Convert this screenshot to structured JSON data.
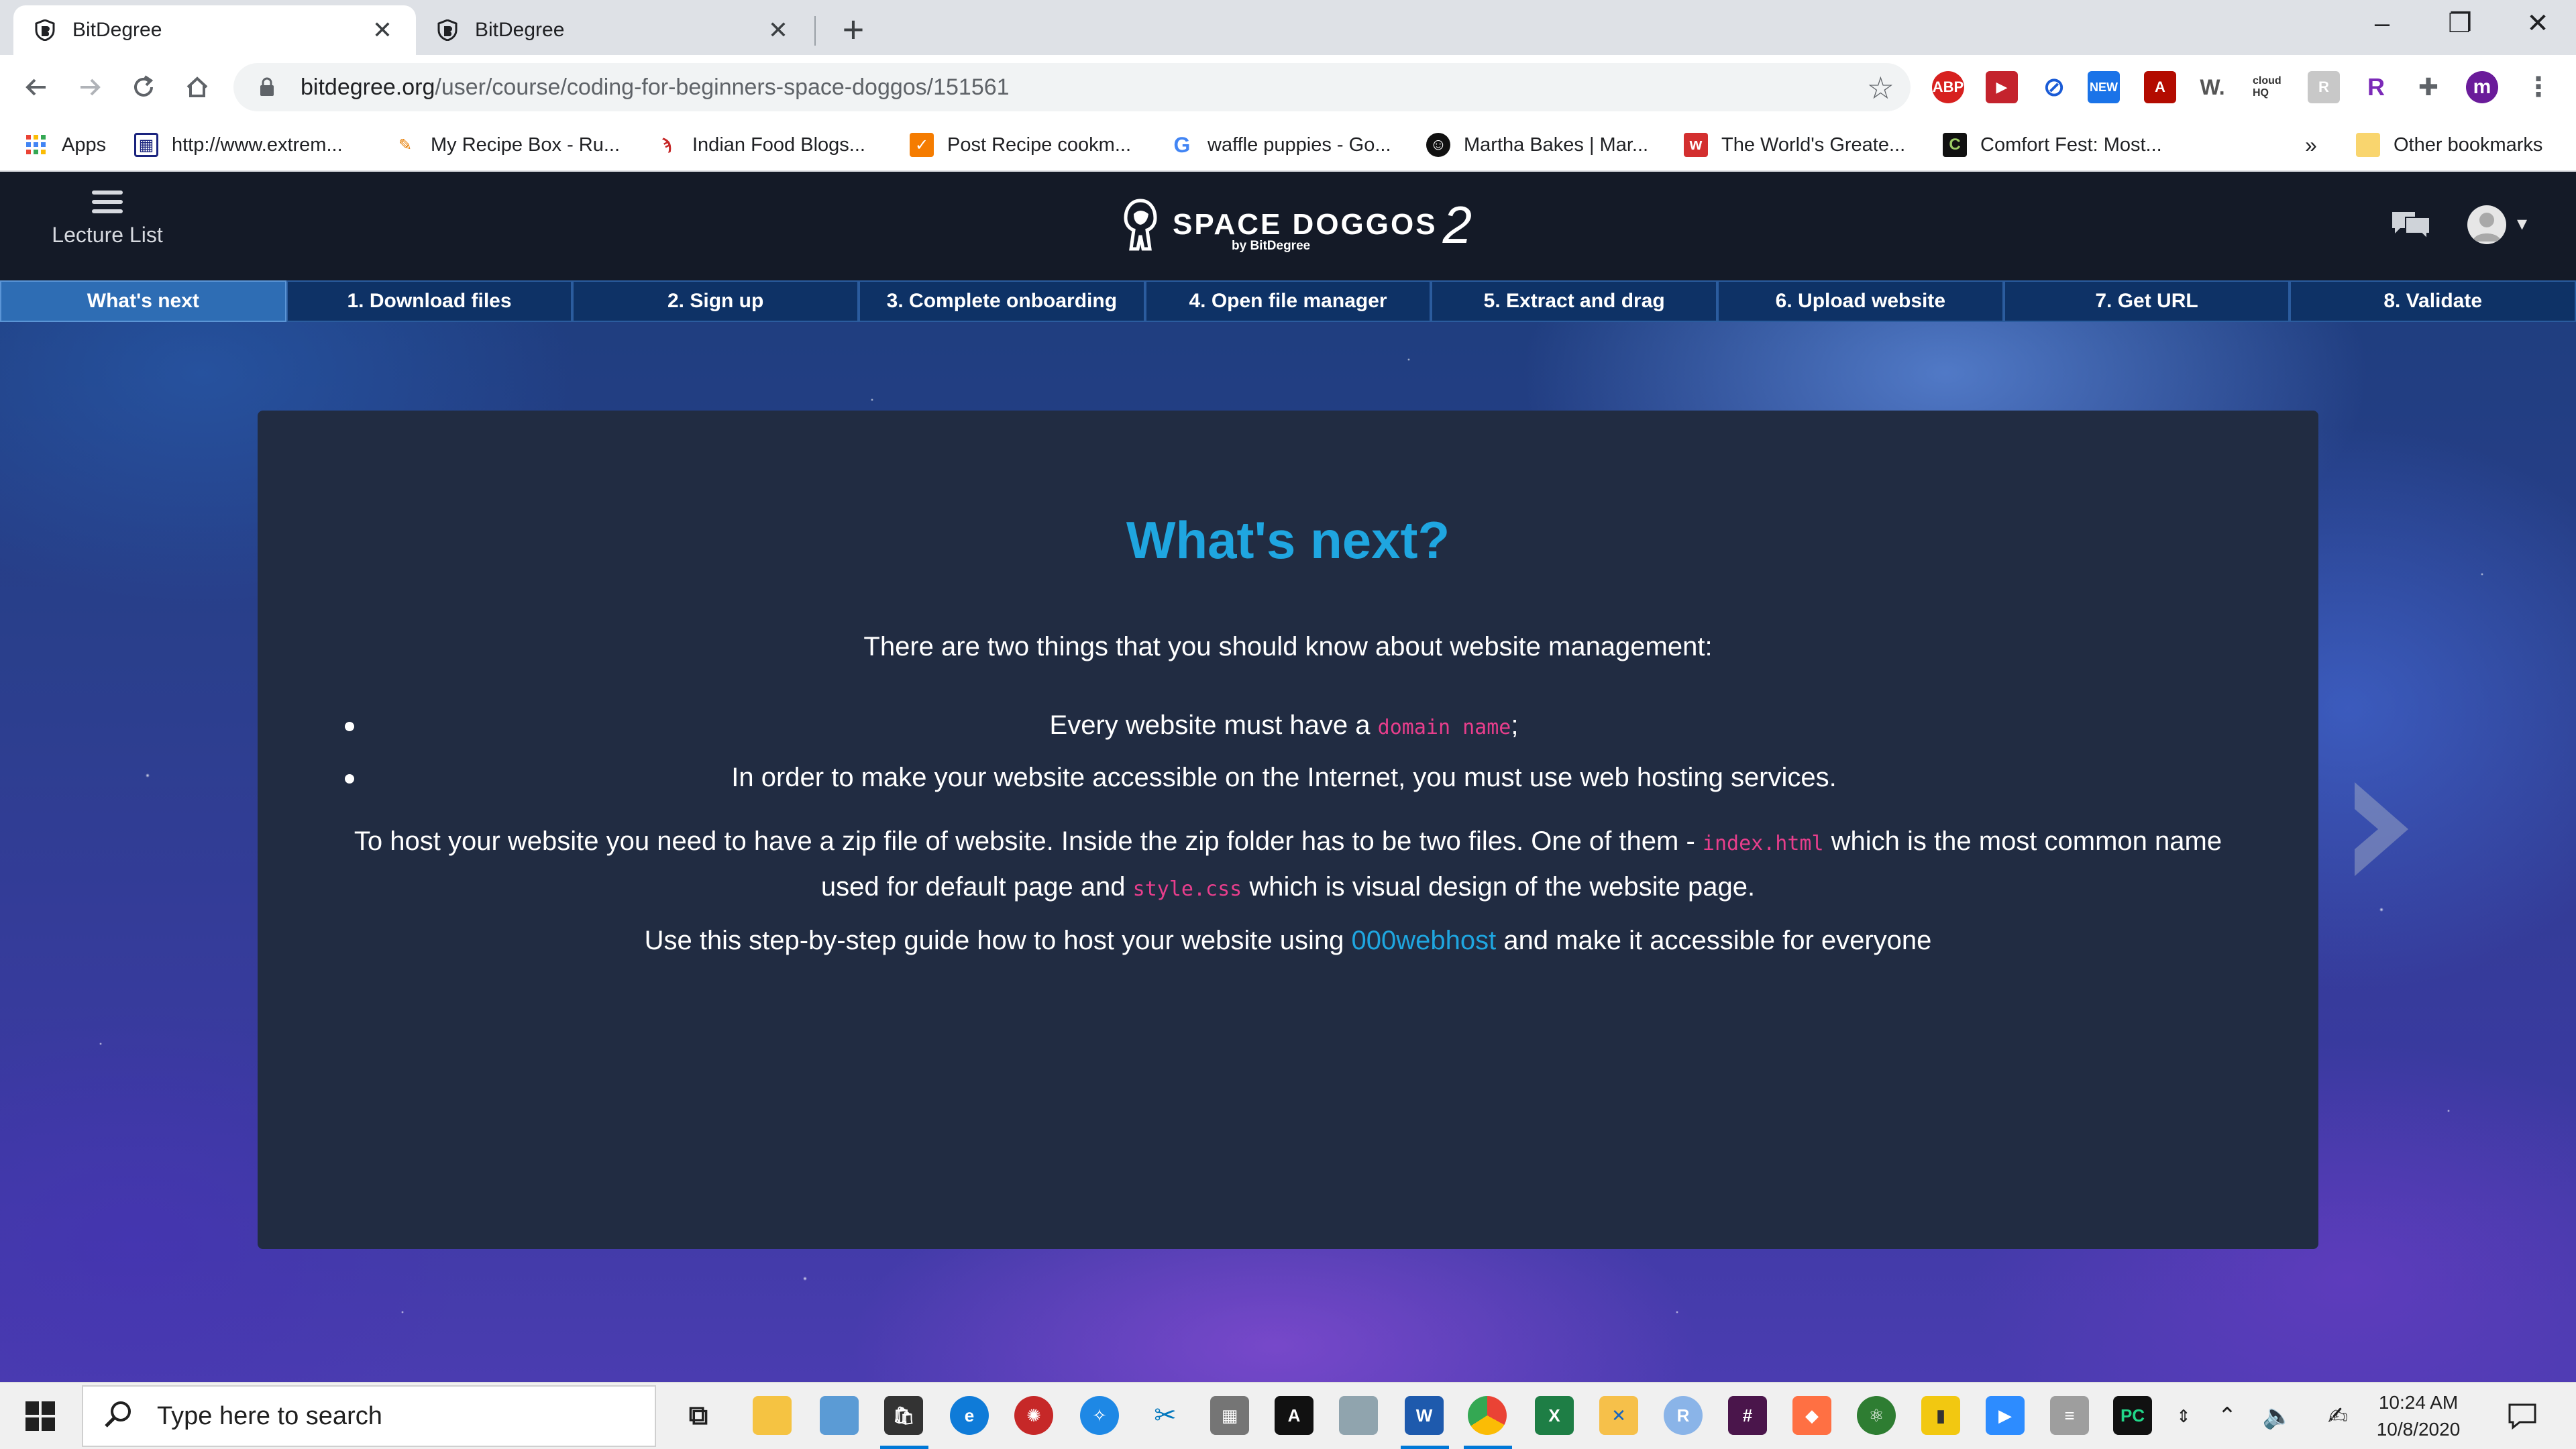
{
  "browser": {
    "tabs": [
      {
        "title": "BitDegree",
        "active": true
      },
      {
        "title": "BitDegree",
        "active": false
      }
    ],
    "window_controls": {
      "minimize": "–",
      "restore": "❐",
      "close": "✕"
    },
    "address": {
      "domain": "bitdegree.org",
      "path": "/user/course/coding-for-beginners-space-doggos/151561"
    },
    "extensions": [
      "ABP",
      "NEW",
      "W.",
      "cloud HQ",
      "R",
      "m"
    ],
    "bookmarks": [
      {
        "label": "Apps",
        "icon": "apps-grid-icon"
      },
      {
        "label": "http://www.extrem...",
        "icon": "grid-icon"
      },
      {
        "label": "My Recipe Box - Ru...",
        "icon": "pencil-icon"
      },
      {
        "label": "Indian Food Blogs...",
        "icon": "swirl-icon"
      },
      {
        "label": "Post Recipe cookm...",
        "icon": "orange-box-icon"
      },
      {
        "label": "waffle puppies - Go...",
        "icon": "google-icon"
      },
      {
        "label": "Martha Bakes | Mar...",
        "icon": "pbs-icon"
      },
      {
        "label": "The World's Greate...",
        "icon": "red-w-icon"
      },
      {
        "label": "Comfort Fest: Most...",
        "icon": "green-c-icon"
      }
    ],
    "bookmarks_overflow": "»",
    "other_bookmarks": "Other bookmarks"
  },
  "site": {
    "lecture_list_label": "Lecture List",
    "brand_name": "SPACE DOGGOS",
    "brand_number": "2",
    "brand_by": "by BitDegree",
    "steps": [
      "What's next",
      "1. Download files",
      "2. Sign up",
      "3. Complete onboarding",
      "4. Open file manager",
      "5. Extract and drag",
      "6. Upload website",
      "7. Get URL",
      "8. Validate"
    ],
    "active_step": 0
  },
  "content": {
    "heading": "What's next?",
    "intro": "There are two things that you should know about website management:",
    "bullet1_prefix": "Every website must have a ",
    "bullet1_code": "domain name",
    "bullet1_suffix": ";",
    "bullet2": "In order to make your website accessible on the Internet, you must use web hosting services.",
    "para2_a": "To host your website you need to have a zip file of website. Inside the zip folder has to be two files. One of them - ",
    "para2_code1": "index.html",
    "para2_b": " which is the most common name used for default page and ",
    "para2_code2": "style.css",
    "para2_c": " which is visual design of the website page.",
    "para3_a": "Use this step-by-step guide how to host your website using ",
    "para3_link": "000webhost",
    "para3_b": " and make it accessible for everyone"
  },
  "taskbar": {
    "search_placeholder": "Type here to search",
    "time": "10:24 AM",
    "date": "10/8/2020"
  },
  "colors": {
    "accent": "#1fa6e0",
    "code": "#e83e8c",
    "card": "#212c42",
    "header": "#141a27",
    "step_active": "#2e6db4",
    "step": "#0e3266"
  }
}
